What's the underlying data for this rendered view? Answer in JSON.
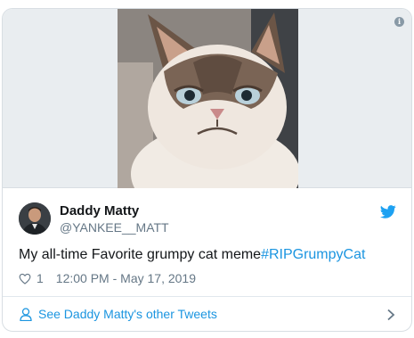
{
  "author": {
    "display_name": "Daddy Matty",
    "handle": "@YANKEE__MATT"
  },
  "tweet": {
    "text": "My all-time Favorite grumpy cat meme",
    "hashtag": "#RIPGrumpyCat",
    "like_count": "1",
    "timestamp": "12:00 PM - May 17, 2019"
  },
  "footer": {
    "more_tweets_label": "See Daddy Matty's other Tweets"
  },
  "icons": {
    "info": "info-icon",
    "platform": "twitter-bird-icon",
    "like": "heart-icon",
    "profile": "person-icon",
    "navigate": "chevron-right-icon"
  },
  "colors": {
    "link": "#1b95e0",
    "muted_text": "#657786",
    "twitter_blue": "#1da1f2",
    "border": "#d8dee3"
  }
}
